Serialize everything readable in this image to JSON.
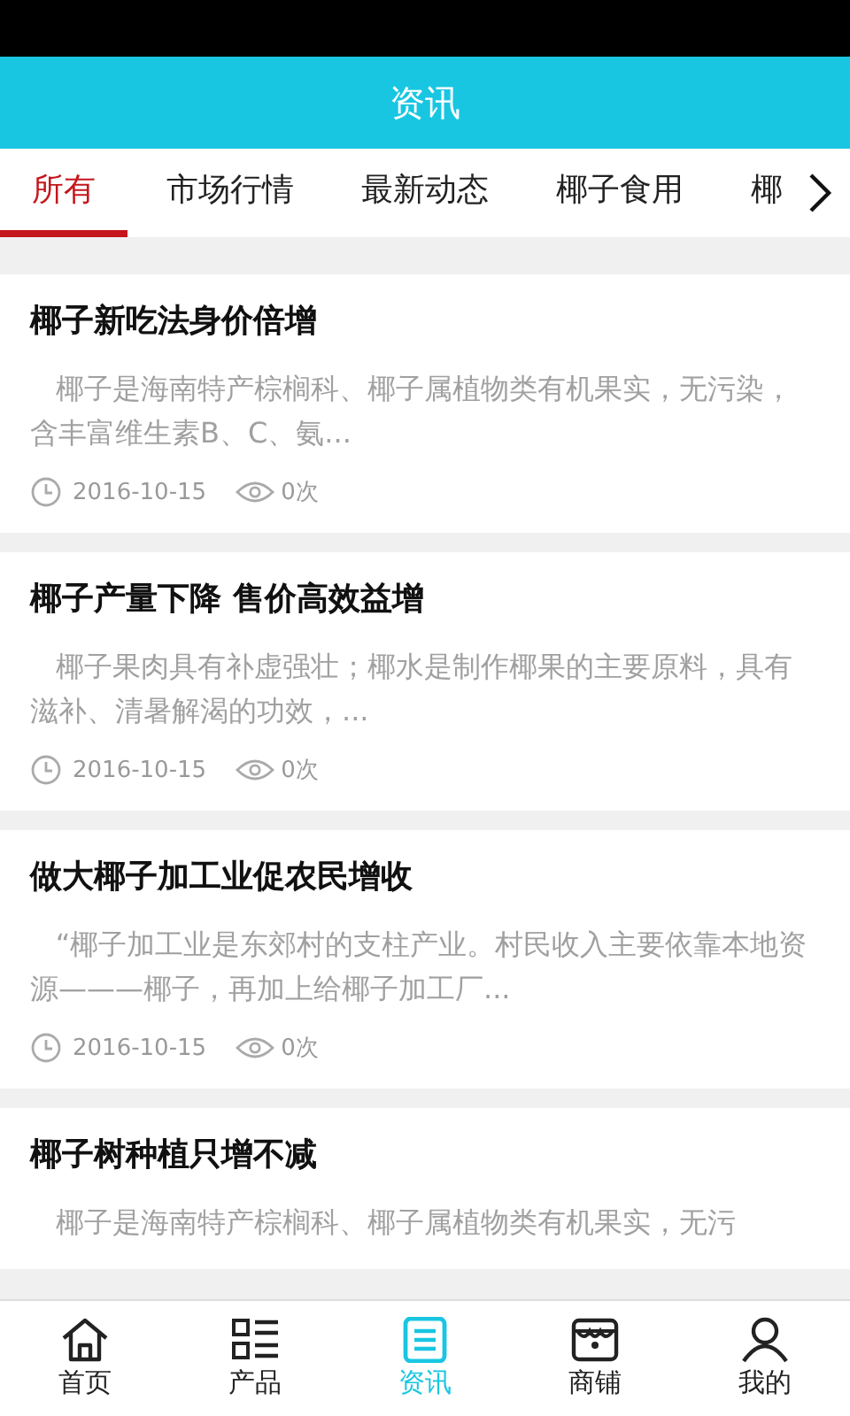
{
  "header": {
    "title": "资讯"
  },
  "tabs": [
    {
      "label": "所有",
      "selected": true
    },
    {
      "label": "市场行情",
      "selected": false
    },
    {
      "label": "最新动态",
      "selected": false
    },
    {
      "label": "椰子食用",
      "selected": false
    },
    {
      "label": "椰",
      "selected": false
    }
  ],
  "articles": [
    {
      "title": "椰子新吃法身价倍增",
      "summary": "椰子是海南特产棕榈科、椰子属植物类有机果实，无污染，含丰富维生素B、C、氨...",
      "date": "2016-10-15",
      "views": "0次"
    },
    {
      "title": "椰子产量下降 售价高效益增",
      "summary": "椰子果肉具有补虚强壮；椰水是制作椰果的主要原料，具有滋补、清暑解渴的功效，...",
      "date": "2016-10-15",
      "views": "0次"
    },
    {
      "title": "做大椰子加工业促农民增收",
      "summary": "“椰子加工业是东郊村的支柱产业。村民收入主要依靠本地资源———椰子，再加上给椰子加工厂...",
      "date": "2016-10-15",
      "views": "0次"
    },
    {
      "title": "椰子树种植只增不减",
      "summary": "椰子是海南特产棕榈科、椰子属植物类有机果实，无污"
    }
  ],
  "bottom_nav": [
    {
      "label": "首页",
      "kind": "home",
      "selected": false
    },
    {
      "label": "产品",
      "kind": "list",
      "selected": false
    },
    {
      "label": "资讯",
      "kind": "news",
      "selected": true
    },
    {
      "label": "商铺",
      "kind": "shop",
      "selected": false
    },
    {
      "label": "我的",
      "kind": "user",
      "selected": false
    }
  ]
}
